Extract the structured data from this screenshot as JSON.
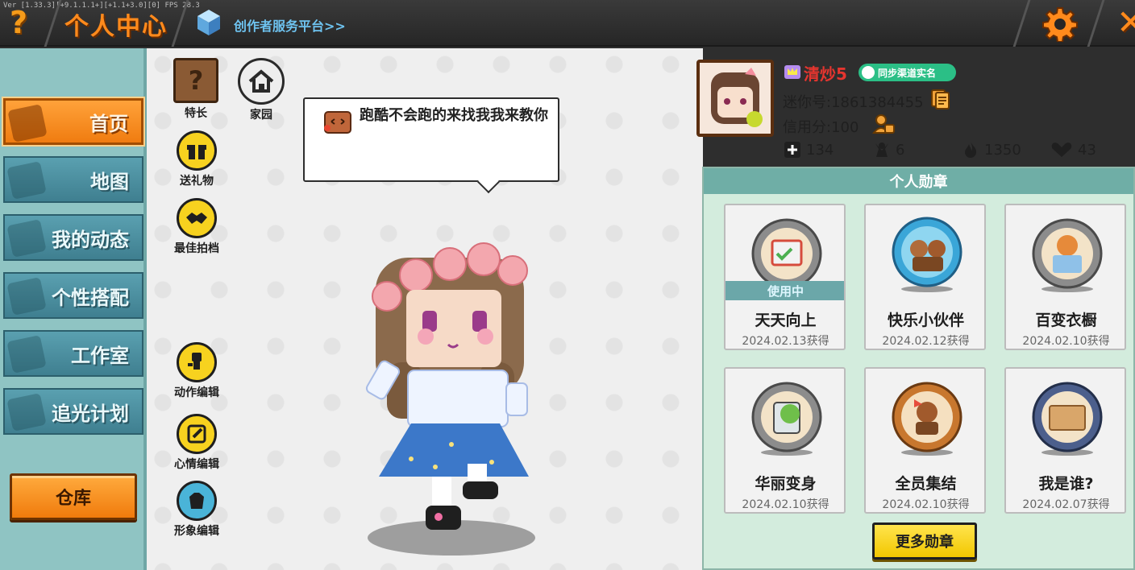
{
  "debug": {
    "version_text": "Ver [1.33.3][+9.1.1.1+][+1.1+3.0][0] FPS 28.3"
  },
  "header": {
    "title": "个人中心",
    "creator_link": "创作者服务平台>>",
    "help_icon": "question-icon",
    "settings_icon": "gear-icon",
    "close_icon": "close-icon"
  },
  "sidebar": {
    "items": [
      {
        "label": "首页",
        "icon": "home-icon",
        "active": true
      },
      {
        "label": "地图",
        "icon": "map-icon",
        "active": false
      },
      {
        "label": "我的动态",
        "icon": "bell-icon",
        "active": false
      },
      {
        "label": "个性搭配",
        "icon": "outfit-icon",
        "active": false
      },
      {
        "label": "工作室",
        "icon": "studio-icon",
        "active": false
      },
      {
        "label": "追光计划",
        "icon": "plan-icon",
        "active": false
      }
    ],
    "warehouse_label": "仓库"
  },
  "actions": {
    "talent": "特长",
    "home": "家园",
    "send_gift": "送礼物",
    "best_partner": "最佳拍档",
    "action_edit": "动作编辑",
    "mood_edit": "心情编辑",
    "image_edit": "形象编辑"
  },
  "speech_bubble": {
    "text": "跑酷不会跑的来找我我来教你"
  },
  "profile": {
    "nickname": "清炒5",
    "sync_badge": "同步渠道实名",
    "mini_id": "迷你号:1861384455",
    "credit": "信用分:100",
    "stats": [
      {
        "icon": "plus-icon",
        "value": "134"
      },
      {
        "icon": "fans-icon",
        "value": "6"
      },
      {
        "icon": "fire-icon",
        "value": "1350"
      },
      {
        "icon": "heart-icon",
        "value": "43"
      }
    ]
  },
  "medals": {
    "title": "个人勋章",
    "in_use_label": "使用中",
    "items": [
      {
        "name": "天天向上",
        "date": "2024.02.13获得",
        "in_use": true,
        "color": "#8c8c8c"
      },
      {
        "name": "快乐小伙伴",
        "date": "2024.02.12获得",
        "in_use": false,
        "color": "#3aa6d8"
      },
      {
        "name": "百变衣橱",
        "date": "2024.02.10获得",
        "in_use": false,
        "color": "#8c8c8c"
      },
      {
        "name": "华丽变身",
        "date": "2024.02.10获得",
        "in_use": false,
        "color": "#8c8c8c"
      },
      {
        "name": "全员集结",
        "date": "2024.02.10获得",
        "in_use": false,
        "color": "#c8772e"
      },
      {
        "name": "我是谁?",
        "date": "2024.02.07获得",
        "in_use": false,
        "color": "#4c5f8c"
      }
    ],
    "more_label": "更多勋章"
  },
  "colors": {
    "accent_orange": "#ff8a1c",
    "sidebar_bg": "#8fc4c3",
    "nickname_red": "#e5352f",
    "badge_green": "#2bbf86",
    "button_yellow": "#f7d21f"
  }
}
